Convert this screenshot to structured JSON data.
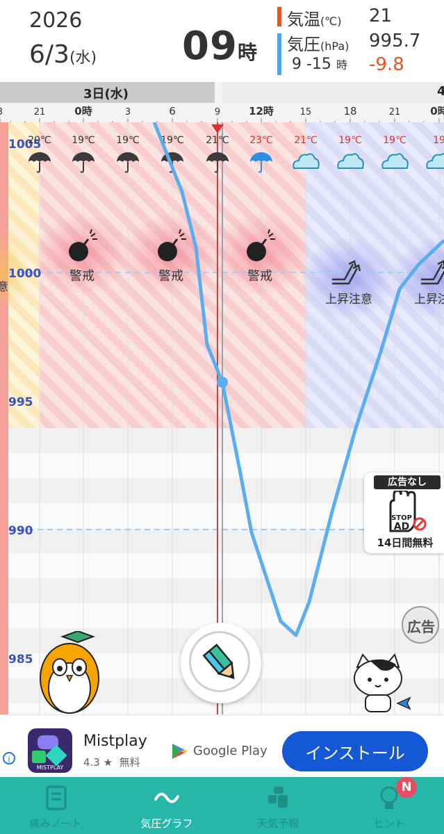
{
  "header": {
    "year": "2026",
    "date": "6/3",
    "weekday": "(水)",
    "hour": "09",
    "hour_unit": "時",
    "temp_label": "気温",
    "temp_unit": "(℃)",
    "temp_value": "21",
    "pressure_label": "気圧",
    "pressure_unit": "(hPa)",
    "pressure_value": "995.7",
    "range_label": "9 -15",
    "range_unit": "時",
    "change_value": "-9.8",
    "colors": {
      "temp": "#e8531f",
      "pressure": "#4aa8f0",
      "change": "#e8531f"
    }
  },
  "ruler": {
    "day_label": "3日(水)",
    "next_day_label": "4",
    "ticks": [
      "3",
      "21",
      "0時",
      "3",
      "6",
      "9",
      "12時",
      "15",
      "18",
      "21",
      "0時"
    ]
  },
  "forecast": {
    "temps": [
      "20℃",
      "19℃",
      "19℃",
      "19℃",
      "21℃",
      "23℃",
      "21℃",
      "19℃",
      "19℃",
      "19"
    ],
    "icons": [
      "umbrella-icon",
      "umbrella-icon",
      "umbrella-icon",
      "umbrella-icon",
      "umbrella-icon",
      "umbrella-blue-icon",
      "cloud-icon",
      "cloud-icon",
      "cloud-icon",
      "cloud-icon"
    ]
  },
  "alerts": {
    "warning": "警戒",
    "rising": "上昇注意",
    "caution_cut": "意"
  },
  "y_axis": {
    "labels": [
      "1005",
      "1000",
      "995",
      "990",
      "985"
    ]
  },
  "promo": {
    "title": "広告なし",
    "stop": "STOP",
    "ad": "AD",
    "days": "14日間無料"
  },
  "ad_toggle_label": "広告",
  "ad": {
    "app_name": "Mistplay",
    "rating": "4.3 ★",
    "price": "無料",
    "store": "Google Play",
    "install": "インストール",
    "icon_caption": "MISTPLAY",
    "info": "i"
  },
  "nav": {
    "items": [
      "痛みノート",
      "気圧グラフ",
      "天気予報",
      "ヒント"
    ],
    "badge": "N",
    "bg_color": "#27b7a8"
  }
}
